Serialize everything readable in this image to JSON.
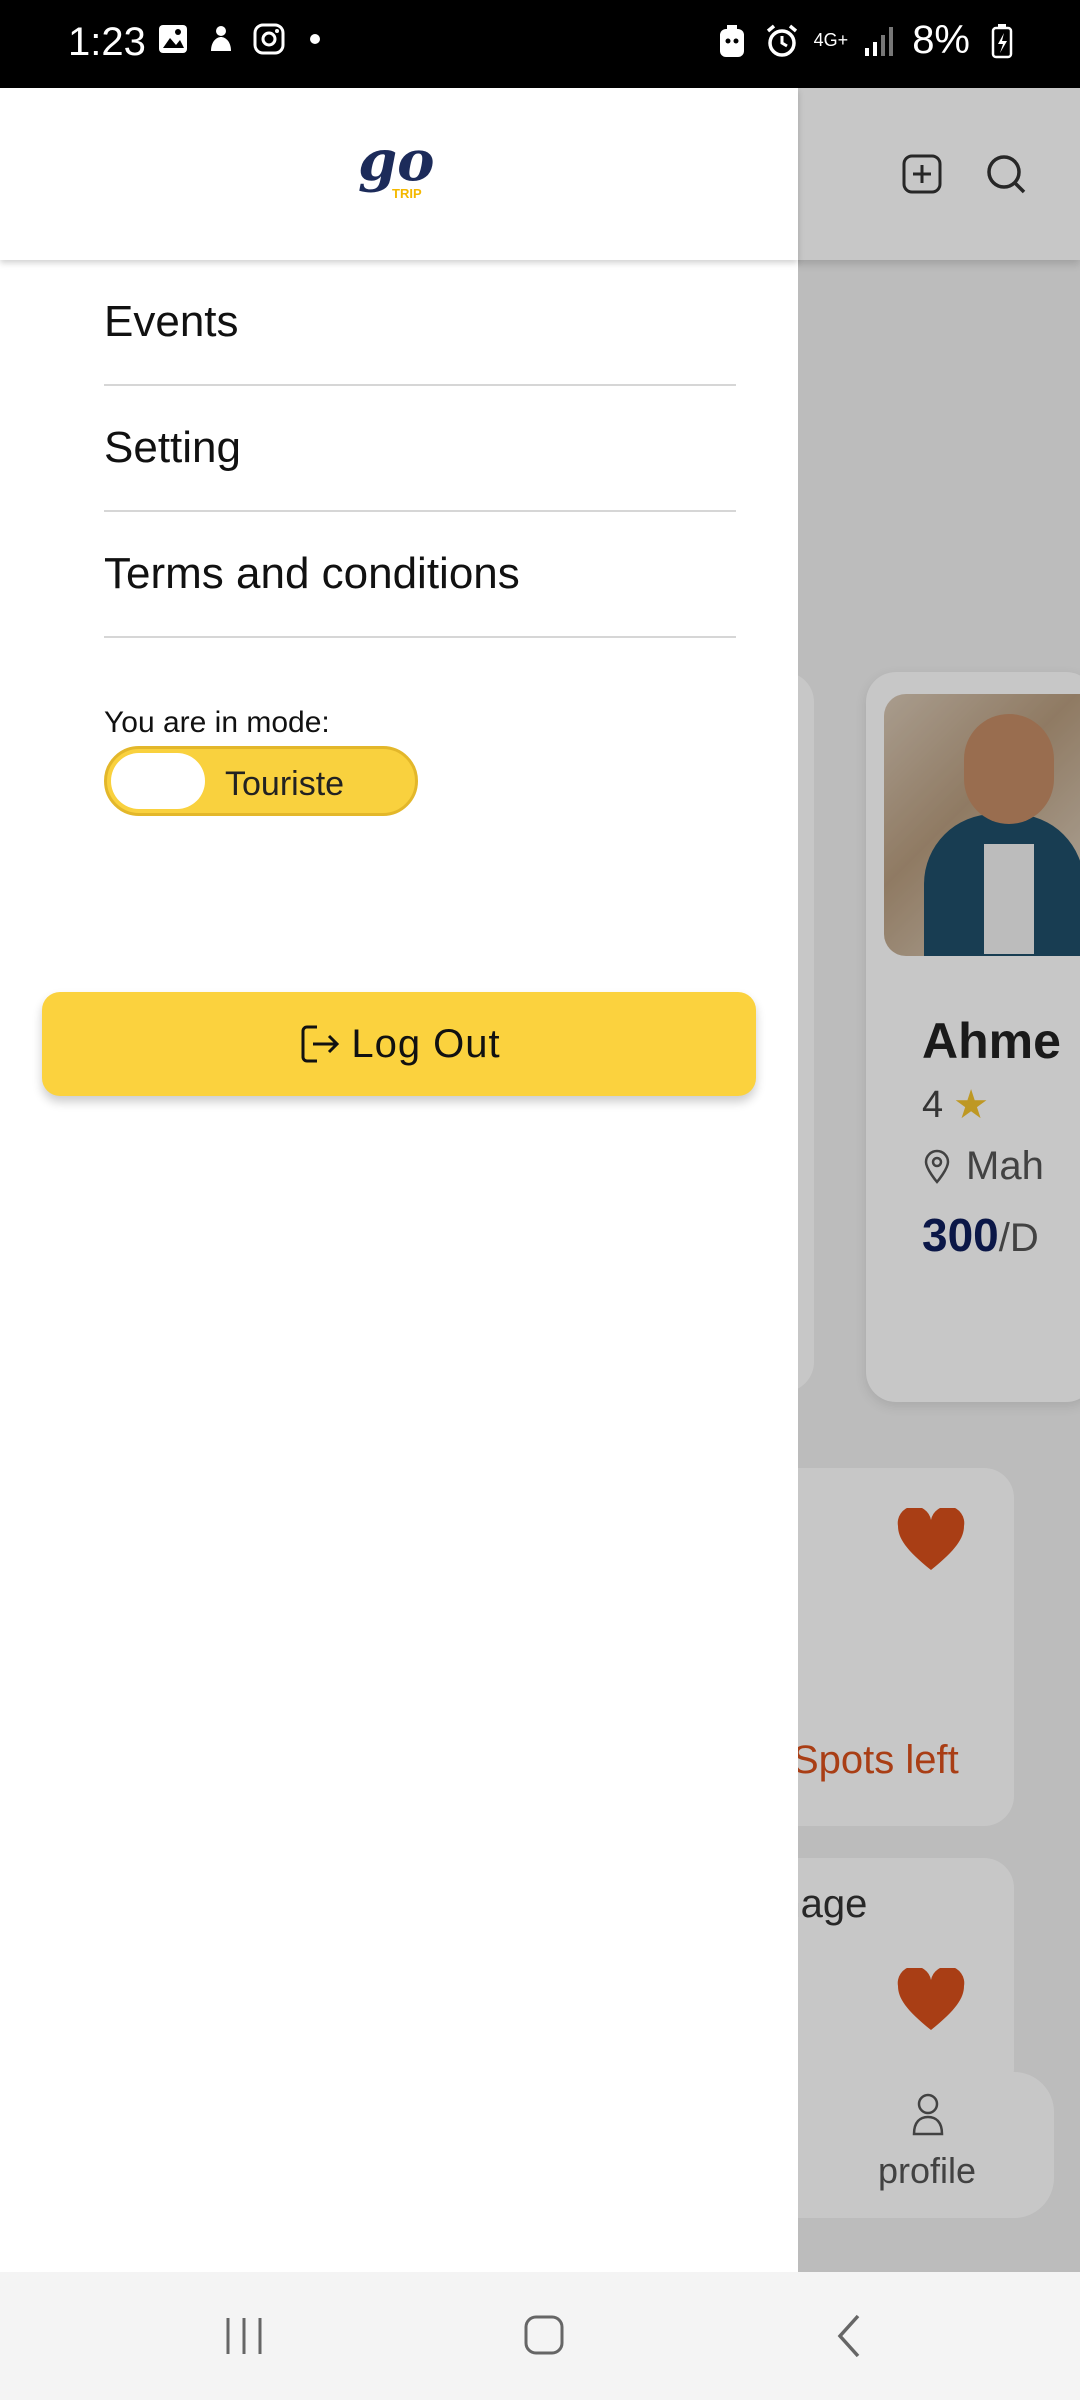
{
  "status_bar": {
    "time": "1:23",
    "network": "4G+",
    "battery": "8%",
    "icons": [
      "gallery-icon",
      "notification-app-icon",
      "instagram-icon",
      "dot-icon",
      "battery-saver-icon",
      "alarm-icon",
      "signal-icon",
      "battery-charging-icon"
    ]
  },
  "drawer": {
    "logo_text": "go",
    "logo_sub": "TRIP",
    "menu": [
      {
        "label": "Events"
      },
      {
        "label": "Setting"
      },
      {
        "label": "Terms and conditions"
      }
    ],
    "mode_label": "You are in mode:",
    "mode_value": "Touriste",
    "logout_label": "Log Out"
  },
  "background": {
    "person": {
      "name": "Ahme",
      "rating": "4",
      "location": "Mah",
      "price": "300",
      "price_unit": "/D"
    },
    "event1_spots": "Spots left",
    "event2_title": "rthage",
    "nav_profile": "profile"
  },
  "colors": {
    "accent_yellow": "#fbd23e",
    "brand_navy": "#1c2b5a",
    "heart_orange": "#d9501c"
  }
}
